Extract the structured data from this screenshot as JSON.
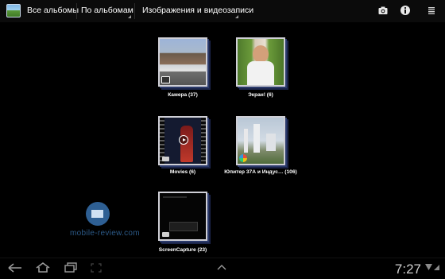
{
  "action_bar": {
    "title": "Все альбомы",
    "group_by": "По альбомам",
    "media_filter": "Изображения и видеозаписи",
    "icons": [
      "gallery-app-icon",
      "camera-icon",
      "info-icon",
      "overflow-menu-icon"
    ]
  },
  "albums": [
    {
      "label": "Камера (37)",
      "badge": "camera-badge-icon"
    },
    {
      "label": "Экран! (6)"
    },
    {
      "label": "Movies (6)",
      "badge": "folder-badge-icon"
    },
    {
      "label": "Юпитер 37А и Индус… (106)",
      "badge": "picasa-badge-icon"
    },
    {
      "label": "ScreenCapture (23)",
      "badge": "folder-badge-icon"
    }
  ],
  "watermark": "mobile-review.com",
  "status_bar": {
    "time": "7:27",
    "icons": [
      "back-icon",
      "home-icon",
      "recent-apps-icon",
      "screenshot-icon",
      "menu-up-icon",
      "wifi-icon",
      "signal-icon"
    ]
  }
}
